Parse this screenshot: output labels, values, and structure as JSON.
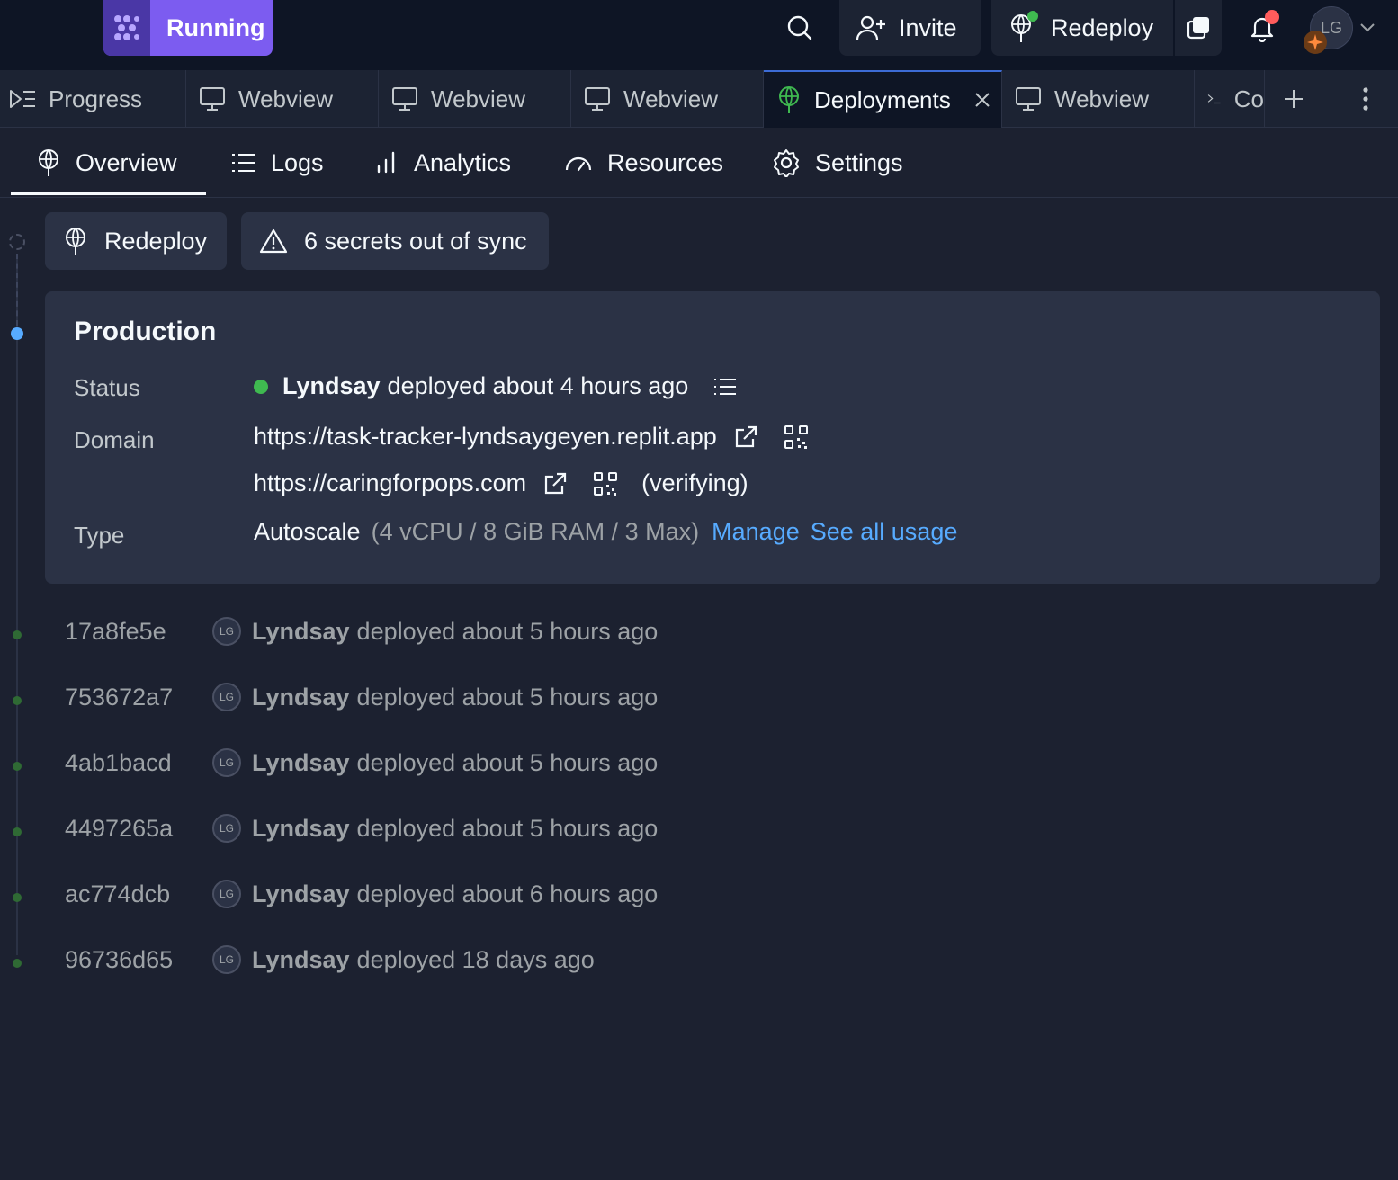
{
  "topbar": {
    "run_label": "Running",
    "invite_label": "Invite",
    "redeploy_label": "Redeploy",
    "avatar_initials": "LG"
  },
  "tabs": [
    {
      "label": "Progress",
      "icon": "progress-icon"
    },
    {
      "label": "Webview",
      "icon": "monitor-icon"
    },
    {
      "label": "Webview",
      "icon": "monitor-icon"
    },
    {
      "label": "Webview",
      "icon": "monitor-icon"
    },
    {
      "label": "Deployments",
      "icon": "deployments-icon",
      "active": true
    },
    {
      "label": "Webview",
      "icon": "monitor-icon"
    },
    {
      "label": "Co",
      "icon": "console-icon"
    }
  ],
  "subnav": [
    {
      "label": "Overview",
      "icon": "deployments-icon",
      "active": true
    },
    {
      "label": "Logs",
      "icon": "list-icon"
    },
    {
      "label": "Analytics",
      "icon": "bar-chart-icon"
    },
    {
      "label": "Resources",
      "icon": "gauge-icon"
    },
    {
      "label": "Settings",
      "icon": "gear-icon"
    }
  ],
  "actions": {
    "redeploy_label": "Redeploy",
    "secrets_label": "6 secrets out of sync"
  },
  "production": {
    "title": "Production",
    "status_label": "Status",
    "status_user": "Lyndsay",
    "status_text": "deployed about 4 hours ago",
    "domain_label": "Domain",
    "domain_primary": "https://task-tracker-lyndsaygeyen.replit.app",
    "domain_secondary": "https://caringforpops.com",
    "domain_secondary_state": "(verifying)",
    "type_label": "Type",
    "type_value": "Autoscale",
    "type_specs": "(4 vCPU / 8 GiB RAM / 3 Max)",
    "manage_link": "Manage",
    "usage_link": "See all usage"
  },
  "history": [
    {
      "id": "17a8fe5e",
      "initials": "LG",
      "user": "Lyndsay",
      "text": "deployed about 5 hours ago"
    },
    {
      "id": "753672a7",
      "initials": "LG",
      "user": "Lyndsay",
      "text": "deployed about 5 hours ago"
    },
    {
      "id": "4ab1bacd",
      "initials": "LG",
      "user": "Lyndsay",
      "text": "deployed about 5 hours ago"
    },
    {
      "id": "4497265a",
      "initials": "LG",
      "user": "Lyndsay",
      "text": "deployed about 5 hours ago"
    },
    {
      "id": "ac774dcb",
      "initials": "LG",
      "user": "Lyndsay",
      "text": "deployed about 6 hours ago"
    },
    {
      "id": "96736d65",
      "initials": "LG",
      "user": "Lyndsay",
      "text": "deployed 18 days ago"
    }
  ],
  "colors": {
    "background": "#1c2130",
    "accent": "#7c5cf0",
    "link": "#57abff",
    "status_ok": "#3fb950",
    "notification": "#ff5c5c"
  }
}
